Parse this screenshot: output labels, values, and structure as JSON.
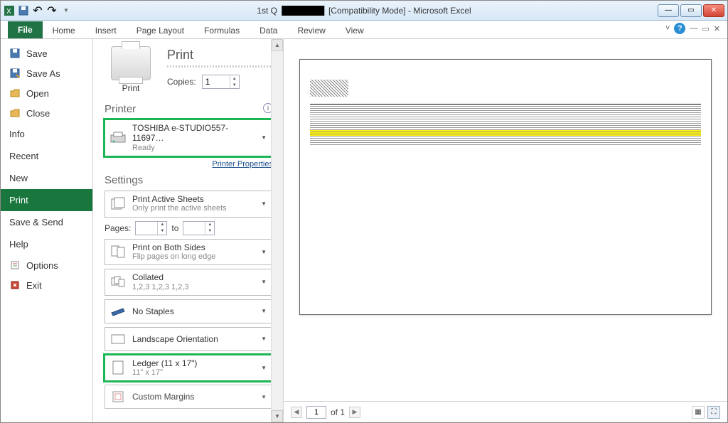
{
  "window": {
    "title_prefix": "1st Q",
    "title_suffix": "[Compatibility Mode]  -  Microsoft Excel"
  },
  "ribbon": {
    "file": "File",
    "tabs": [
      "Home",
      "Insert",
      "Page Layout",
      "Formulas",
      "Data",
      "Review",
      "View"
    ]
  },
  "nav": {
    "save": "Save",
    "save_as": "Save As",
    "open": "Open",
    "close": "Close",
    "info": "Info",
    "recent": "Recent",
    "new": "New",
    "print": "Print",
    "save_send": "Save & Send",
    "help": "Help",
    "options": "Options",
    "exit": "Exit"
  },
  "print": {
    "heading": "Print",
    "button_label": "Print",
    "copies_label": "Copies:",
    "copies_value": "1",
    "printer_section": "Printer",
    "printer_name": "TOSHIBA e-STUDIO557-11697…",
    "printer_status": "Ready",
    "printer_properties": "Printer Properties",
    "settings_section": "Settings",
    "active_sheets_main": "Print Active Sheets",
    "active_sheets_sub": "Only print the active sheets",
    "pages_label": "Pages:",
    "pages_to": "to",
    "both_sides_main": "Print on Both Sides",
    "both_sides_sub": "Flip pages on long edge",
    "collated_main": "Collated",
    "collated_sub": "1,2,3    1,2,3    1,2,3",
    "staples": "No Staples",
    "orientation": "Landscape Orientation",
    "paper_main": "Ledger (11 x 17\")",
    "paper_sub": "11\" x 17\"",
    "margins": "Custom Margins"
  },
  "preview": {
    "page_current": "1",
    "page_of": "of 1"
  }
}
